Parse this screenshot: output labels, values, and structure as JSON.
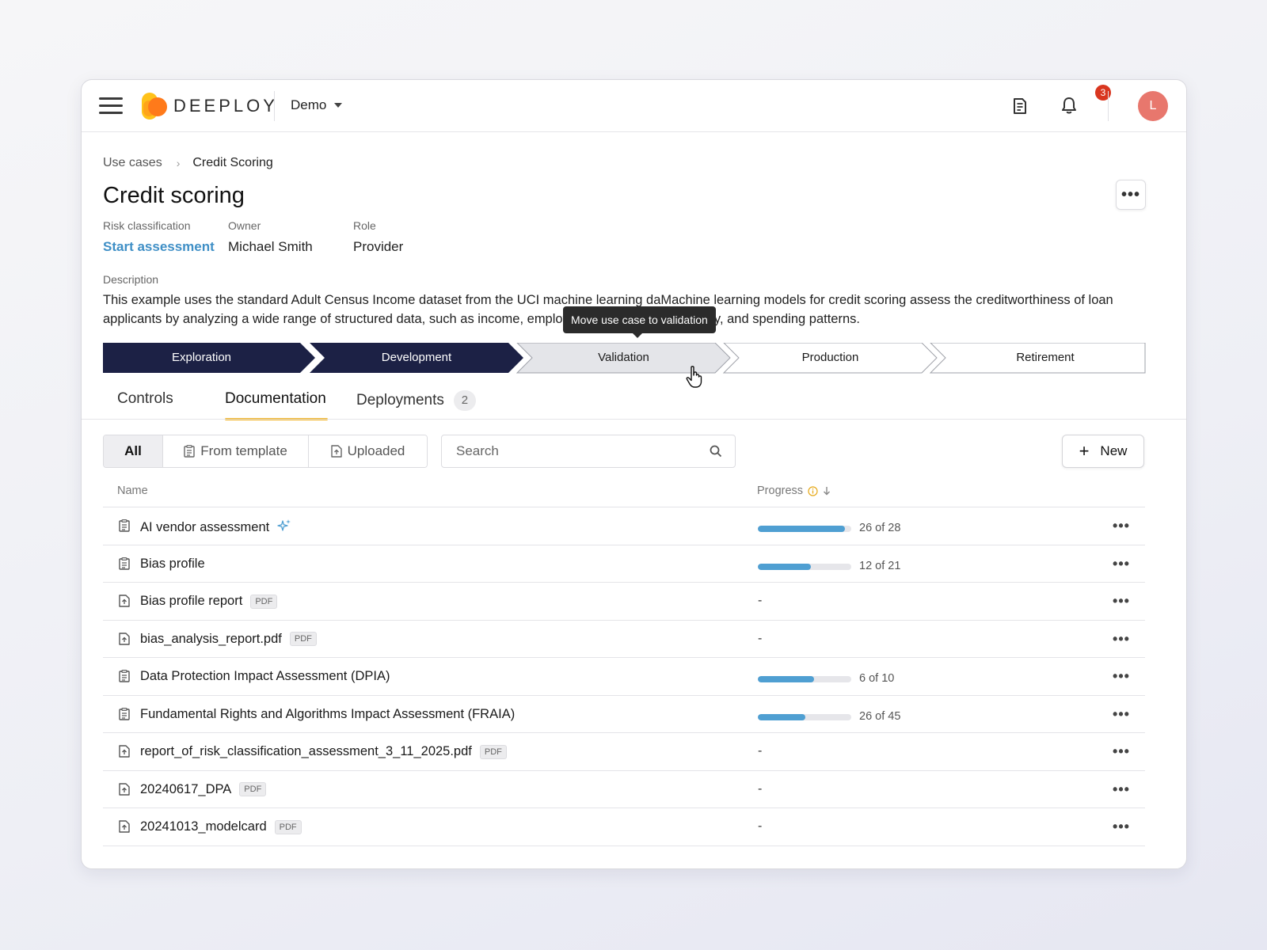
{
  "header": {
    "brand": "DEEPLOY",
    "workspace": "Demo",
    "notification_count": "3",
    "avatar_initial": "L"
  },
  "breadcrumb": {
    "parent": "Use cases",
    "current": "Credit Scoring"
  },
  "page": {
    "title": "Credit scoring",
    "risk_label": "Risk classification",
    "risk_value": "Start assessment",
    "owner_label": "Owner",
    "owner_value": "Michael Smith",
    "role_label": "Role",
    "role_value": "Provider",
    "description_label": "Description",
    "description": "This example uses the standard Adult Census Income dataset from the UCI machine learning daMachine learning models for credit scoring assess the creditworthiness of loan applicants by analyzing a wide range of structured data, such as income, employment history, credit history, and spending patterns."
  },
  "stages": [
    {
      "label": "Exploration",
      "state": "done"
    },
    {
      "label": "Development",
      "state": "done"
    },
    {
      "label": "Validation",
      "state": "hover"
    },
    {
      "label": "Production",
      "state": "todo"
    },
    {
      "label": "Retirement",
      "state": "todo"
    }
  ],
  "tooltip": "Move use case to validation",
  "tabs": [
    {
      "label": "Controls"
    },
    {
      "label": "Documentation",
      "active": true
    },
    {
      "label": "Deployments",
      "count": "2"
    }
  ],
  "filters": {
    "all": "All",
    "from_template": "From template",
    "uploaded": "Uploaded"
  },
  "search": {
    "placeholder": "Search"
  },
  "new_button": "New",
  "table": {
    "col_name": "Name",
    "col_progress": "Progress",
    "rows": [
      {
        "name": "AI vendor assessment",
        "icon": "template-doc-icon",
        "sparkle": true,
        "progress": 0.93,
        "progress_text": "26 of 28"
      },
      {
        "name": "Bias profile",
        "icon": "template-doc-icon",
        "progress": 0.57,
        "progress_text": "12 of 21"
      },
      {
        "name": "Bias profile report",
        "icon": "uploaded-file-icon",
        "tag": "PDF",
        "progress_text": "-"
      },
      {
        "name": "bias_analysis_report.pdf",
        "icon": "uploaded-file-icon",
        "tag": "PDF",
        "progress_text": "-"
      },
      {
        "name": "Data Protection Impact Assessment (DPIA)",
        "icon": "template-doc-icon",
        "progress": 0.6,
        "progress_text": "6 of 10"
      },
      {
        "name": "Fundamental Rights and Algorithms Impact Assessment (FRAIA)",
        "icon": "template-doc-icon",
        "progress": 0.51,
        "progress_text": "26 of 45"
      },
      {
        "name": "report_of_risk_classification_assessment_3_11_2025.pdf",
        "icon": "uploaded-file-icon",
        "tag": "PDF",
        "progress_text": "-"
      },
      {
        "name": "20240617_DPA",
        "icon": "uploaded-file-icon",
        "tag": "PDF",
        "progress_text": "-"
      },
      {
        "name": "20241013_modelcard",
        "icon": "uploaded-file-icon",
        "tag": "PDF",
        "progress_text": "-"
      }
    ]
  },
  "colors": {
    "stage_done": "#1c2145",
    "stage_hover": "#e4e5e9",
    "accent": "#f2b21c",
    "link": "#3f8fc6",
    "progress": "#4f9fd2",
    "badge": "#d9361f"
  }
}
